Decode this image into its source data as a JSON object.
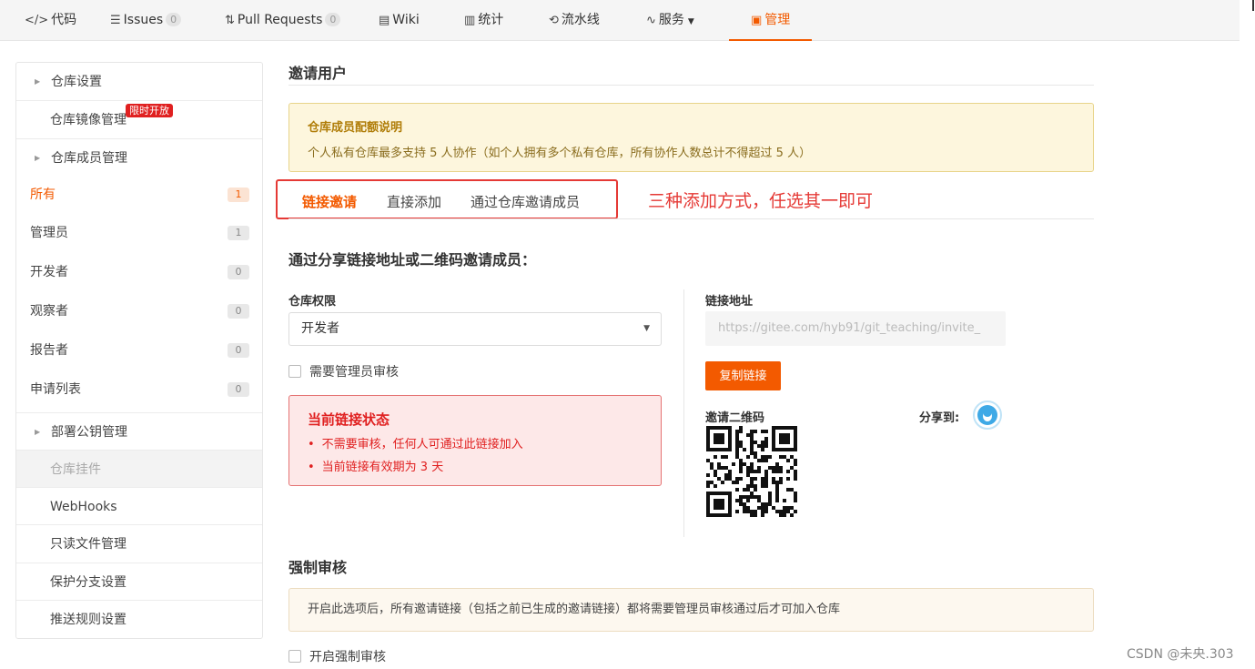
{
  "nav": {
    "items": [
      {
        "icon": "code-icon",
        "glyph": "</>",
        "label": "代码"
      },
      {
        "icon": "issues-icon",
        "glyph": "☰",
        "label": "Issues",
        "count": "0"
      },
      {
        "icon": "pull-request-icon",
        "glyph": "⇅",
        "label": "Pull Requests",
        "count": "0"
      },
      {
        "icon": "wiki-icon",
        "glyph": "▤",
        "label": "Wiki"
      },
      {
        "icon": "stats-icon",
        "glyph": "▥",
        "label": "统计"
      },
      {
        "icon": "pipeline-icon",
        "glyph": "⟲",
        "label": "流水线"
      },
      {
        "icon": "service-icon",
        "glyph": "∿",
        "label": "服务"
      },
      {
        "icon": "manage-icon",
        "glyph": "▣",
        "label": "管理"
      }
    ],
    "active_color": "#f35a00"
  },
  "sidebar": {
    "repo_settings": "仓库设置",
    "mirror_manage": "仓库镜像管理",
    "hot_badge": "限时开放",
    "member_manage": "仓库成员管理",
    "members": [
      {
        "label": "所有",
        "count": "1"
      },
      {
        "label": "管理员",
        "count": "1"
      },
      {
        "label": "开发者",
        "count": "0"
      },
      {
        "label": "观察者",
        "count": "0"
      },
      {
        "label": "报告者",
        "count": "0"
      },
      {
        "label": "申请列表",
        "count": "0"
      }
    ],
    "deploy_keys": "部署公钥管理",
    "repo_plugins": "仓库挂件",
    "webhooks": "WebHooks",
    "readonly_files": "只读文件管理",
    "protected_branches": "保护分支设置",
    "push_rules": "推送规则设置"
  },
  "main": {
    "title": "邀请用户",
    "quota_notice": {
      "title": "仓库成员配额说明",
      "desc": "个人私有仓库最多支持 5 人协作（如个人拥有多个私有仓库，所有协作人数总计不得超过 5 人）"
    },
    "tabs": [
      "链接邀请",
      "直接添加",
      "通过仓库邀请成员"
    ],
    "annotation": "三种添加方式，任选其一即可",
    "share_heading": "通过分享链接地址或二维码邀请成员：",
    "permission_label": "仓库权限",
    "permission_value": "开发者",
    "need_review": "需要管理员审核",
    "status": {
      "title": "当前链接状态",
      "items": [
        "不需要审核，任何人可通过此链接加入",
        "当前链接有效期为 3 天"
      ]
    },
    "link_label": "链接地址",
    "link_value": "https://gitee.com/hyb91/git_teaching/invite_",
    "copy_button": "复制链接",
    "qr_label": "邀请二维码",
    "share_to": "分享到:",
    "force_review": {
      "title": "强制审核",
      "notice": "开启此选项后，所有邀请链接（包括之前已生成的邀请链接）都将需要管理员审核通过后才可加入仓库",
      "checkbox": "开启强制审核"
    }
  },
  "watermark": "CSDN @未央.303"
}
